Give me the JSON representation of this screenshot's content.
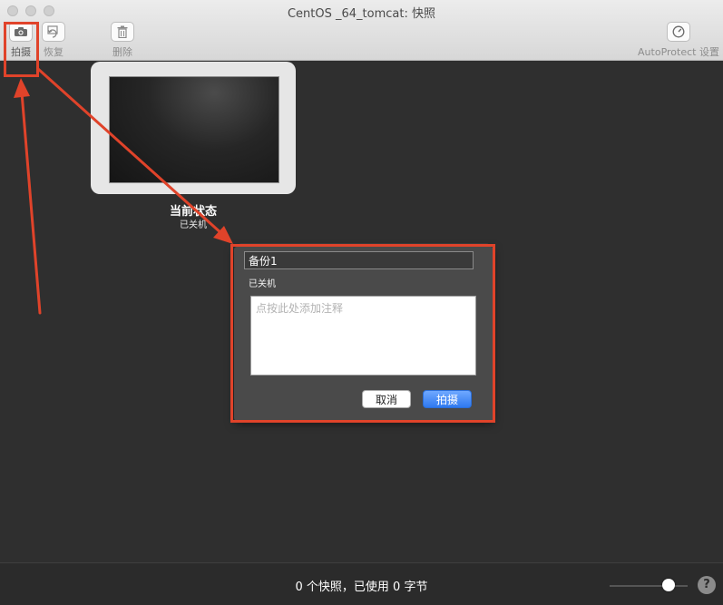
{
  "window": {
    "title": "CentOS _64_tomcat: 快照"
  },
  "toolbar": {
    "take_label": "拍摄",
    "restore_label": "恢复",
    "delete_label": "删除",
    "autoprotect_label": "AutoProtect 设置"
  },
  "snapshot": {
    "title": "当前状态",
    "subtitle": "已关机"
  },
  "dialog": {
    "name_value": "备份1",
    "state": "已关机",
    "note_placeholder": "点按此处添加注释",
    "cancel_label": "取消",
    "confirm_label": "拍摄"
  },
  "statusbar": {
    "text": "0 个快照，已使用 0 字节",
    "zoom_level": 0.75,
    "help_label": "?"
  },
  "colors": {
    "accent": "#3b82f6",
    "annotation": "#e0432a",
    "background": "#2f2f2f"
  }
}
